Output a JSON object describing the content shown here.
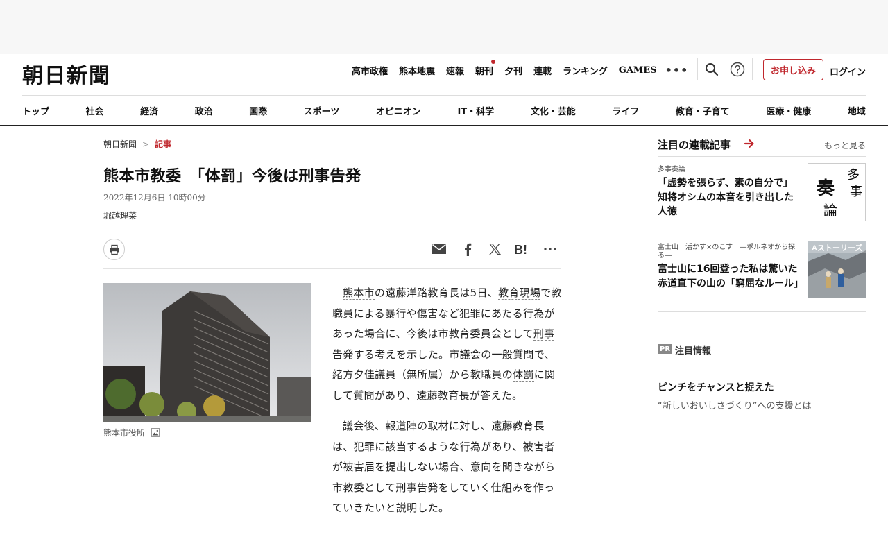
{
  "site": {
    "logo": "朝日新聞"
  },
  "quick_nav": [
    {
      "label": "高市政権",
      "dot": false
    },
    {
      "label": "熊本地震",
      "dot": false
    },
    {
      "label": "速報",
      "dot": false
    },
    {
      "label": "朝刊",
      "dot": true
    },
    {
      "label": "夕刊",
      "dot": false
    },
    {
      "label": "連載",
      "dot": false
    },
    {
      "label": "ランキング",
      "dot": false
    },
    {
      "label": "GAMES",
      "dot": false
    }
  ],
  "header": {
    "more": "•••",
    "subscribe": "お申し込み",
    "login": "ログイン"
  },
  "categories": [
    "トップ",
    "社会",
    "経済",
    "政治",
    "国際",
    "スポーツ",
    "オピニオン",
    "IT・科学",
    "文化・芸能",
    "ライフ",
    "教育・子育て",
    "医療・健康",
    "地域"
  ],
  "breadcrumb": {
    "home": "朝日新聞",
    "separator": ">",
    "current": "記事"
  },
  "article": {
    "title": "熊本市教委　「体罰」今後は刑事告発",
    "date": "2022年12月6日 10時00分",
    "author": "堀越理菜",
    "caption": "熊本市役所",
    "p1": {
      "a": "熊本市",
      "b": "の遠藤洋路教育長は5日、",
      "c": "教育現場",
      "d": "で教職員による暴行や傷害など犯罪にあたる行為があった場合に、今後は市教育委員会として",
      "e": "刑事告発",
      "f": "する考えを示した。市議会の一般質問で、緒方夕佳議員（無所属）から教職員の",
      "g": "体罰",
      "h": "に関して質問があり、遠藤教育長が答えた。"
    },
    "p2": "議会後、報道陣の取材に対し、遠藤教育長は、犯罪に該当するような行為があり、被害者が被害届を提出しない場合、意向を聞きながら市教委として刑事告発をしていく仕組みを作っていきたいと説明した。"
  },
  "sidebar": {
    "title": "注目の連載記事",
    "more": "もっと見る",
    "items": [
      {
        "tag": "多事奏論",
        "title": "「虚勢を張らず、素の自分で」　知将オシムの本音を引き出した人徳",
        "thumb_text": [
          "多",
          "事",
          "奏",
          "論"
        ]
      },
      {
        "tag": "富士山　活かす×のこす　―ポルネオから探る―",
        "title": "富士山に16回登った私は驚いた　赤道直下の山の「窮屈なルール」",
        "thumb_text": [
          "Aストーリーズ"
        ]
      }
    ],
    "pr": {
      "badge": "PR",
      "label": "注目情報",
      "title": "ピンチをチャンスと捉えた",
      "sub": "“新しいおいしさづくり”への支援とは"
    }
  },
  "colors": {
    "accent": "#c0272d",
    "text": "#222222",
    "border": "#dddddd"
  }
}
